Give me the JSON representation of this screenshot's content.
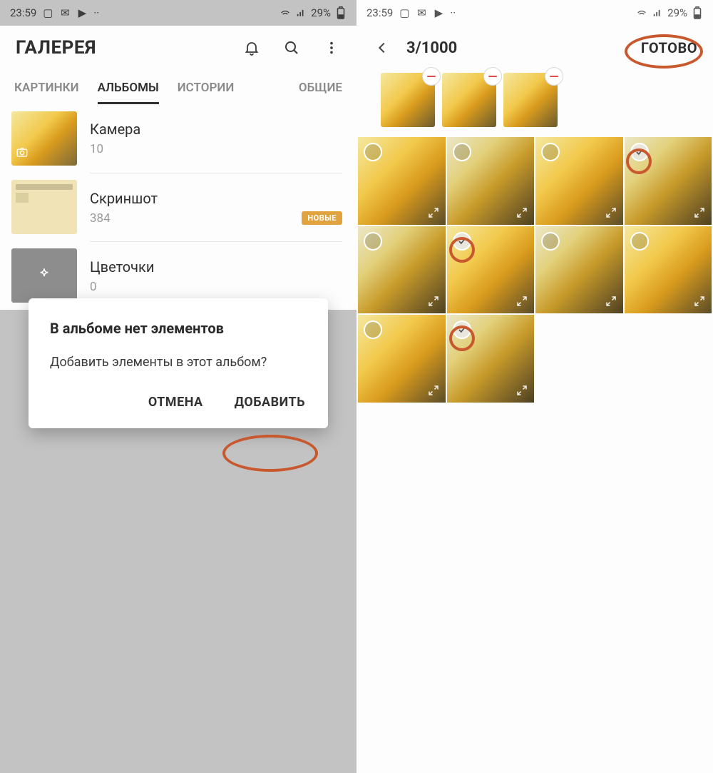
{
  "status": {
    "time": "23:59",
    "battery": "29%"
  },
  "left": {
    "title": "ГАЛЕРЕЯ",
    "tabs": {
      "t0": "КАРТИНКИ",
      "t1": "АЛЬБОМЫ",
      "t2": "ИСТОРИИ",
      "t3": "ОБЩИЕ"
    },
    "albums": [
      {
        "title": "Камера",
        "count": "10"
      },
      {
        "title": "Скриншот",
        "count": "384",
        "badge": "НОВЫЕ"
      },
      {
        "title": "Цветочки",
        "count": "0"
      }
    ],
    "dialog": {
      "title": "В альбоме нет элементов",
      "body": "Добавить элементы в этот альбом?",
      "cancel": "ОТМЕНА",
      "add": "ДОБАВИТЬ"
    }
  },
  "right": {
    "counter": "3/1000",
    "done": "ГОТОВО",
    "grid": {
      "selected": [
        false,
        false,
        false,
        true,
        false,
        true,
        false,
        false,
        false,
        true
      ]
    }
  }
}
